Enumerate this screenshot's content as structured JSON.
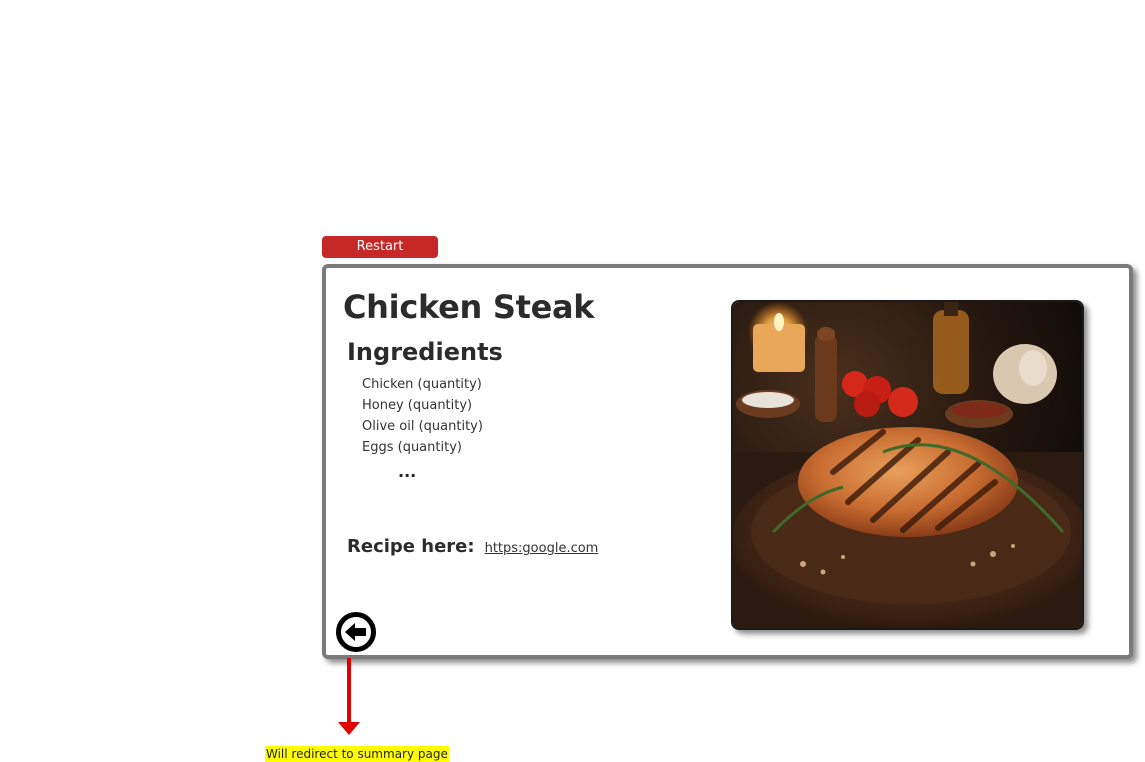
{
  "controls": {
    "restart_label": "Restart"
  },
  "recipe_card": {
    "title": "Chicken Steak",
    "ingredients_heading": "Ingredients",
    "ingredients": [
      "Chicken (quantity)",
      "Honey (quantity)",
      "Olive oil (quantity)",
      "Eggs (quantity)"
    ],
    "more_indicator": "...",
    "recipe_label": "Recipe here:",
    "recipe_link_text": "https:google.com",
    "back_icon": "arrow-left-circle-icon",
    "image_subject": "grilled chicken steak"
  },
  "annotation": {
    "note": "Will redirect to summary page",
    "arrow_color": "#e00000",
    "highlight_color": "#ffff00"
  },
  "colors": {
    "restart": "#c62828",
    "card_border": "#7a7a7a",
    "heading_text": "#2b2b2b"
  }
}
